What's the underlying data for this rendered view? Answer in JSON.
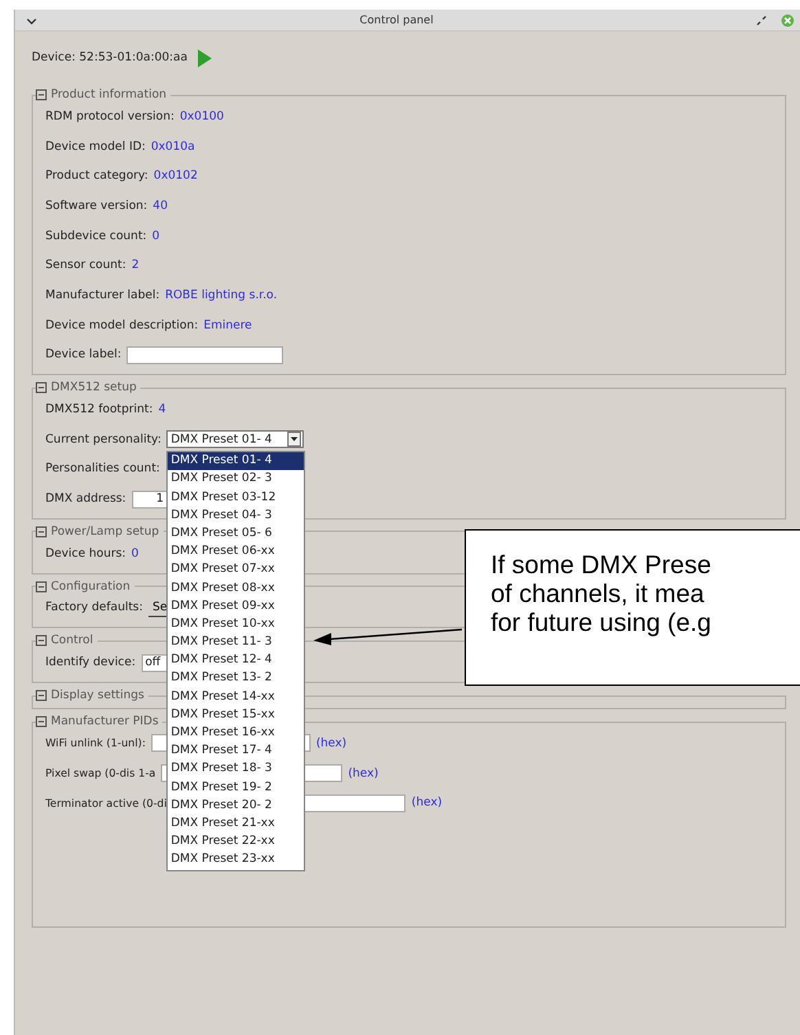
{
  "window": {
    "title": "Control panel"
  },
  "device": {
    "label": "Device: 52:53-01:0a:00:aa"
  },
  "sections": [
    {
      "title": "Product information",
      "rows": [
        {
          "kind": "value",
          "label": "RDM protocol version:",
          "value": "0x0100"
        },
        {
          "kind": "value",
          "label": "Device model ID:",
          "value": "0x010a"
        },
        {
          "kind": "value",
          "label": "Product category:",
          "value": "0x0102"
        },
        {
          "kind": "value",
          "label": "Software version:",
          "value": "40"
        },
        {
          "kind": "value",
          "label": "Subdevice count:",
          "value": "0"
        },
        {
          "kind": "value",
          "label": "Sensor count:",
          "value": "2"
        },
        {
          "kind": "value",
          "label": "Manufacturer label:",
          "value": "ROBE lighting s.r.o."
        },
        {
          "kind": "value",
          "label": "Device model description:",
          "value": "Eminere"
        },
        {
          "kind": "field",
          "label": "Device label:"
        }
      ]
    },
    {
      "title": "DMX512 setup",
      "rows": [
        {
          "kind": "value",
          "label": "DMX512 footprint:",
          "value": "4"
        },
        {
          "kind": "combo",
          "label": "Current personality:",
          "value": "DMX Preset 01- 4",
          "expanded": true,
          "options": [
            {
              "label": "DMX Preset 01- 4",
              "selected": true
            },
            {
              "label": "DMX Preset 02- 3",
              "selected": false
            },
            {
              "label": "DMX Preset 03-12",
              "selected": false
            },
            {
              "label": "DMX Preset 04- 3",
              "selected": false
            },
            {
              "label": "DMX Preset 05- 6",
              "selected": false
            },
            {
              "label": "DMX Preset 06-xx",
              "selected": false
            },
            {
              "label": "DMX Preset 07-xx",
              "selected": false
            },
            {
              "label": "DMX Preset 08-xx",
              "selected": false
            },
            {
              "label": "DMX Preset 09-xx",
              "selected": false
            },
            {
              "label": "DMX Preset 10-xx",
              "selected": false
            },
            {
              "label": "DMX Preset 11- 3",
              "selected": false
            },
            {
              "label": "DMX Preset 12- 4",
              "selected": false
            },
            {
              "label": "DMX Preset 13- 2",
              "selected": false
            },
            {
              "label": "DMX Preset 14-xx",
              "selected": false
            },
            {
              "label": "DMX Preset 15-xx",
              "selected": false
            },
            {
              "label": "DMX Preset 16-xx",
              "selected": false
            },
            {
              "label": "DMX Preset 17- 4",
              "selected": false
            },
            {
              "label": "DMX Preset 18- 3",
              "selected": false
            },
            {
              "label": "DMX Preset 19- 2",
              "selected": false
            },
            {
              "label": "DMX Preset 20- 2",
              "selected": false
            },
            {
              "label": "DMX Preset 21-xx",
              "selected": false
            },
            {
              "label": "DMX Preset 22-xx",
              "selected": false
            },
            {
              "label": "DMX Preset 23-xx",
              "selected": false
            }
          ]
        },
        {
          "kind": "value",
          "label": "Personalities count:"
        },
        {
          "kind": "field",
          "label": "DMX address:",
          "value": "1"
        }
      ]
    },
    {
      "title": "Power/Lamp setup",
      "rows": [
        {
          "kind": "value",
          "label": "Device hours:",
          "value": "0"
        }
      ]
    },
    {
      "title": "Configuration",
      "rows": [
        {
          "kind": "button",
          "label": "Factory defaults:",
          "value": "Se"
        }
      ]
    },
    {
      "title": "Control",
      "rows": [
        {
          "kind": "combo",
          "label": "Identify device:",
          "value": "off"
        }
      ]
    },
    {
      "title": "Display settings"
    },
    {
      "title": "Manufacturer PIDs",
      "rows": [
        {
          "kind": "hexfield",
          "label": "WiFi unlink (1-unl):",
          "suffix": "(hex)"
        },
        {
          "kind": "hexfield",
          "label": "Pixel swap (0-dis 1-a",
          "suffix": "(hex)"
        },
        {
          "kind": "hexfield",
          "label": "Terminator active (0-di",
          "suffix": "(hex)"
        }
      ]
    }
  ],
  "callout": {
    "lines": [
      "If some DMX Prese",
      "of channels, it mea",
      "for future using (e.g"
    ]
  }
}
